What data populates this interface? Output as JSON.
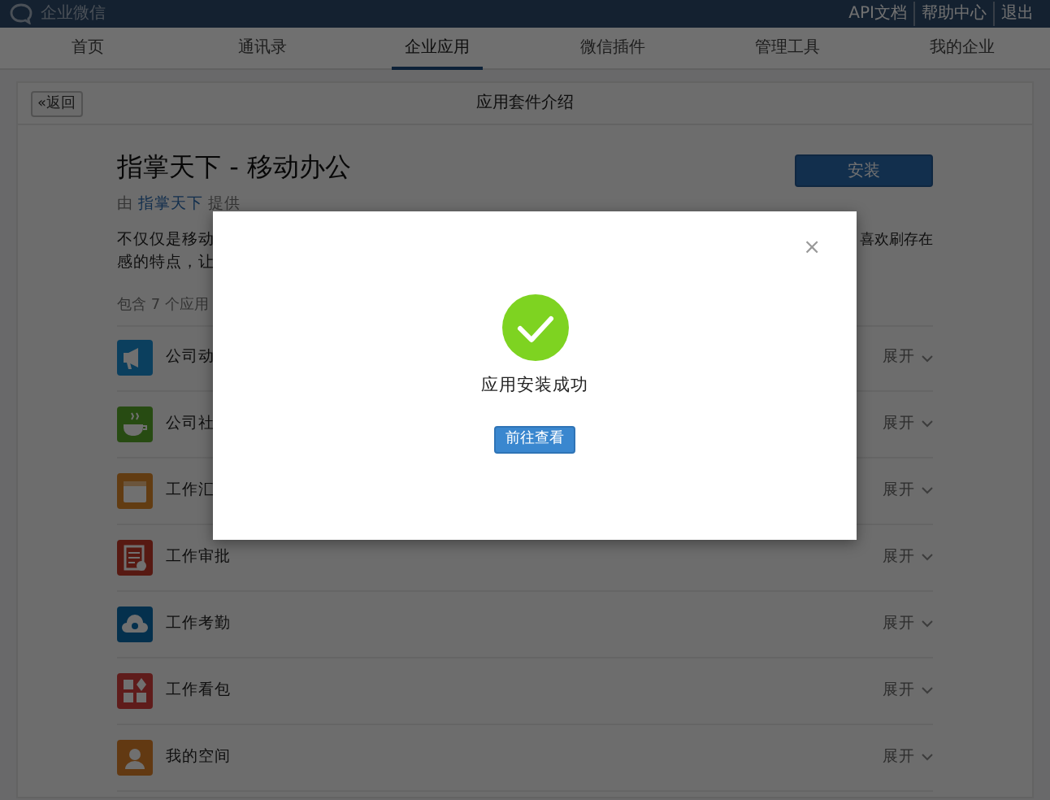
{
  "top_bar": {
    "logo": "企业微信",
    "links": [
      "API文档",
      "帮助中心",
      "退出"
    ]
  },
  "nav": [
    {
      "label": "首页",
      "selected": false
    },
    {
      "label": "通讯录",
      "selected": false
    },
    {
      "label": "企业应用",
      "selected": true
    },
    {
      "label": "微信插件",
      "selected": false
    },
    {
      "label": "管理工具",
      "selected": false
    },
    {
      "label": "我的企业",
      "selected": false
    }
  ],
  "page": {
    "back_arrow": "«",
    "back": "返回",
    "title": "应用套件介绍"
  },
  "suite": {
    "title": "指掌天下 - 移动办公",
    "provider_prefix": "由",
    "provider": "指掌天下",
    "provider_suffix": "提供",
    "install": "安装",
    "description_lines": [
      {
        "left": "不仅仅是移动",
        "right": "喜欢刷存在"
      },
      {
        "left": "感的特点，让"
      }
    ],
    "count": "包含 7 个应用"
  },
  "apps": [
    {
      "name": "公司动",
      "kind": "megaphone",
      "expand": "展开"
    },
    {
      "name": "公司社",
      "kind": "cup",
      "expand": "展开"
    },
    {
      "name": "工作汇",
      "kind": "calendar",
      "expand": "展开"
    },
    {
      "name": "工作审批",
      "kind": "form",
      "expand": "展开"
    },
    {
      "name": "工作考勤",
      "kind": "cloud",
      "expand": "展开"
    },
    {
      "name": "工作看包",
      "kind": "grid",
      "expand": "展开"
    },
    {
      "name": "我的空间",
      "kind": "person",
      "expand": "展开"
    }
  ],
  "dialog": {
    "close": "×",
    "message": "应用安装成功",
    "button": "前往查看"
  }
}
